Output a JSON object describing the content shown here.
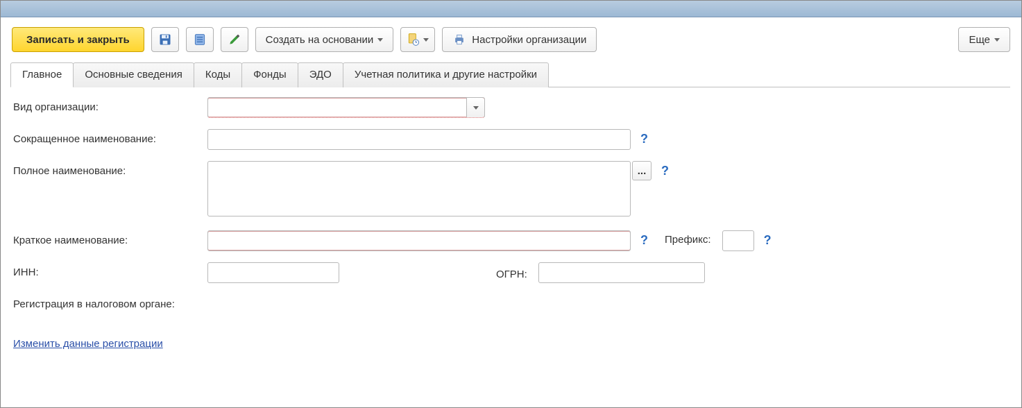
{
  "toolbar": {
    "save_close": "Записать и закрыть",
    "create_based": "Создать на основании",
    "org_settings": "Настройки организации",
    "more": "Еще"
  },
  "tabs": [
    {
      "label": "Главное"
    },
    {
      "label": "Основные сведения"
    },
    {
      "label": "Коды"
    },
    {
      "label": "Фонды"
    },
    {
      "label": "ЭДО"
    },
    {
      "label": "Учетная политика и другие настройки"
    }
  ],
  "form": {
    "org_type_label": "Вид организации:",
    "org_type_value": "",
    "short_name_label": "Сокращенное наименование:",
    "short_name_value": "",
    "full_name_label": "Полное наименование:",
    "full_name_value": "",
    "brief_name_label": "Краткое наименование:",
    "brief_name_value": "",
    "prefix_label": "Префикс:",
    "prefix_value": "",
    "inn_label": "ИНН:",
    "inn_value": "",
    "ogrn_label": "ОГРН:",
    "ogrn_value": "",
    "tax_reg_label": "Регистрация в налоговом органе:",
    "change_reg_link": "Изменить данные регистрации",
    "help": "?",
    "ellipsis": "..."
  }
}
